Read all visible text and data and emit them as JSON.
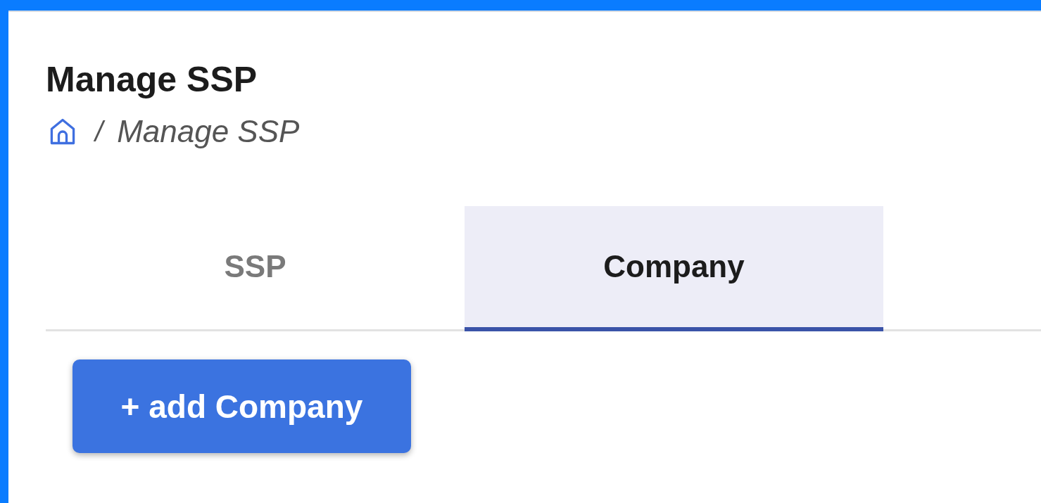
{
  "page": {
    "title": "Manage SSP"
  },
  "breadcrumb": {
    "separator": "/",
    "items": [
      "Manage SSP"
    ]
  },
  "tabs": [
    {
      "label": "SSP",
      "selected": false
    },
    {
      "label": "Company",
      "selected": true
    }
  ],
  "actions": [
    {
      "label": "+ add Company"
    }
  ]
}
